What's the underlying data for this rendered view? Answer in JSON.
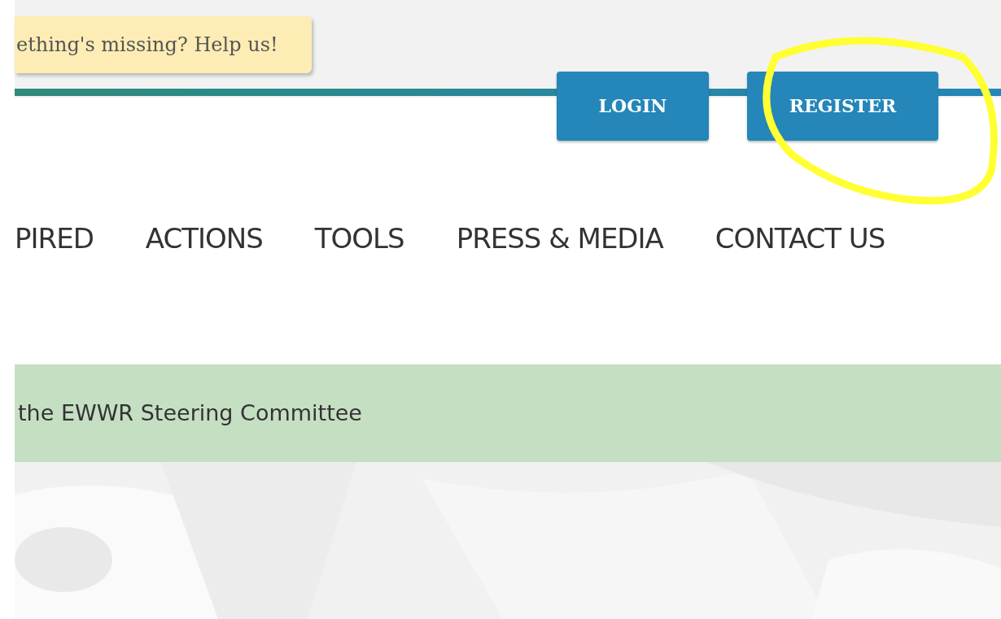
{
  "notice": {
    "text": "ething's missing? Help us!"
  },
  "auth_buttons": [
    {
      "label": "LOGIN"
    },
    {
      "label": "REGISTER"
    }
  ],
  "nav": [
    {
      "label": "PIRED"
    },
    {
      "label": "ACTIONS"
    },
    {
      "label": "TOOLS"
    },
    {
      "label": "PRESS & MEDIA"
    },
    {
      "label": "CONTACT US"
    }
  ],
  "banner": {
    "text": "the EWWR Steering Committee"
  },
  "highlight": {
    "kind": "circle"
  }
}
